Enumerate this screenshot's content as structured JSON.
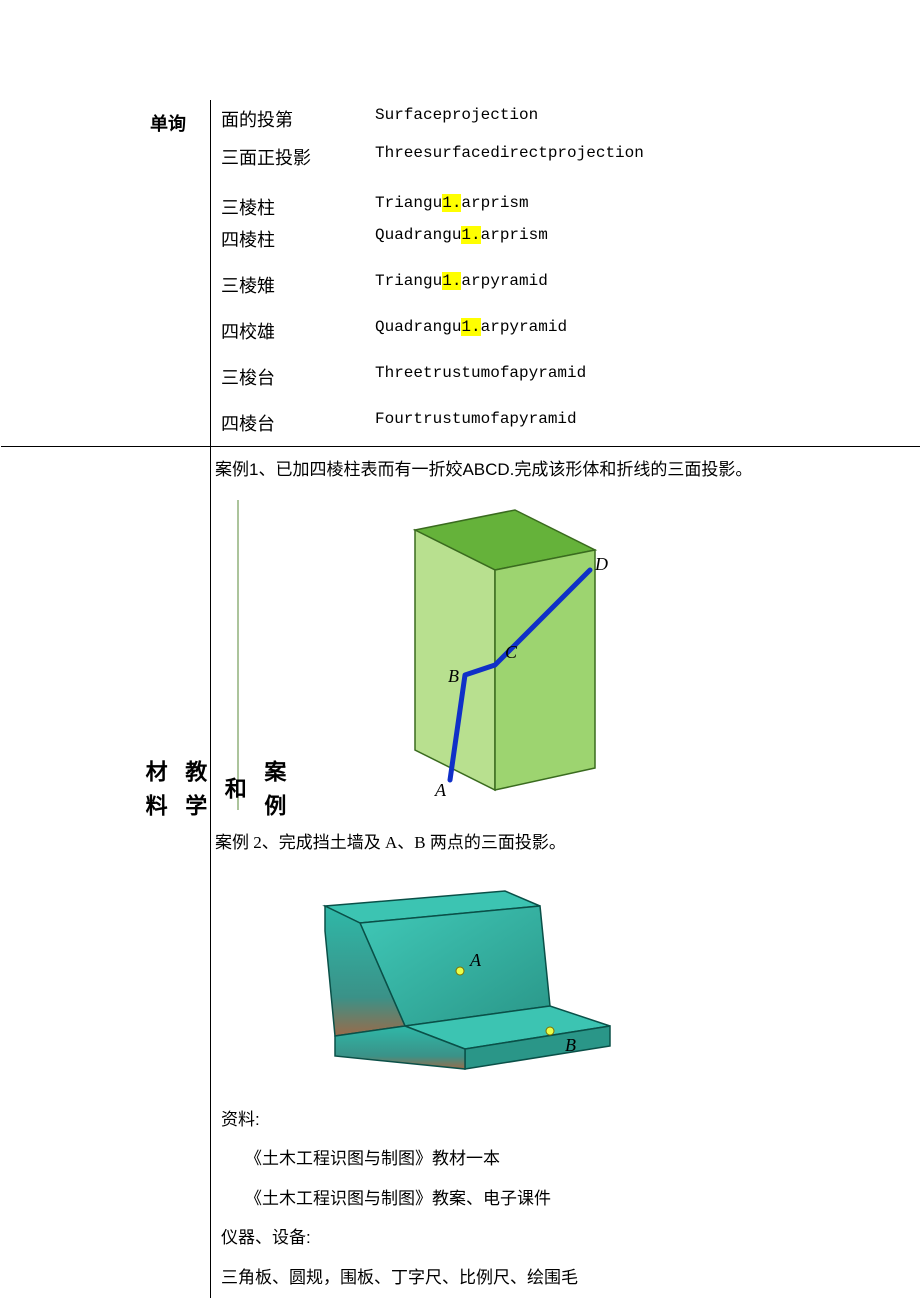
{
  "labels": {
    "danxun": "单询",
    "anli_duo": "案例\n和\n教学\n材料"
  },
  "vocab": [
    {
      "cn": "面的投第",
      "en_pre": "Surfaceprojection",
      "hl": "",
      "en_post": ""
    },
    {
      "cn": "三面正投影",
      "en_pre": "Threesurfacedirectprojection",
      "hl": "",
      "en_post": ""
    },
    {
      "cn": "三棱柱",
      "en_pre": "Triangu",
      "hl": "1.",
      "en_post": "arprism"
    },
    {
      "cn": "四棱柱",
      "en_pre": "Quadrangu",
      "hl": "1.",
      "en_post": "arprism"
    },
    {
      "cn": "三棱雉",
      "en_pre": "Triangu",
      "hl": "1.",
      "en_post": "arpyramid"
    },
    {
      "cn": "四校雄",
      "en_pre": "Quadrangu",
      "hl": "1.",
      "en_post": "arpyramid"
    },
    {
      "cn": "三梭台",
      "en_pre": "Threetrustumofapyramid",
      "hl": "",
      "en_post": ""
    },
    {
      "cn": "四棱台",
      "en_pre": "Fourtrustumofapyramid",
      "hl": "",
      "en_post": ""
    }
  ],
  "case1": "案例1、已加四棱柱表而有一折姣ABCD.完成该形体和折线的三面投影。",
  "case2": "案例 2、完成挡土墙及 A、B 两点的三面投影。",
  "prism_labels": {
    "a": "A",
    "b": "B",
    "c": "C",
    "d": "D"
  },
  "wall_labels": {
    "a": "A",
    "b": "B"
  },
  "materials": {
    "ziliao": "资料:",
    "book1": "《土木工程识图与制图》教材一本",
    "book2": "《土木工程识图与制图》教案、电子课件",
    "yiqi": "仪器、设备:",
    "tools": "三角板、圆规，围板、丁字尺、比例尺、绘围毛"
  }
}
